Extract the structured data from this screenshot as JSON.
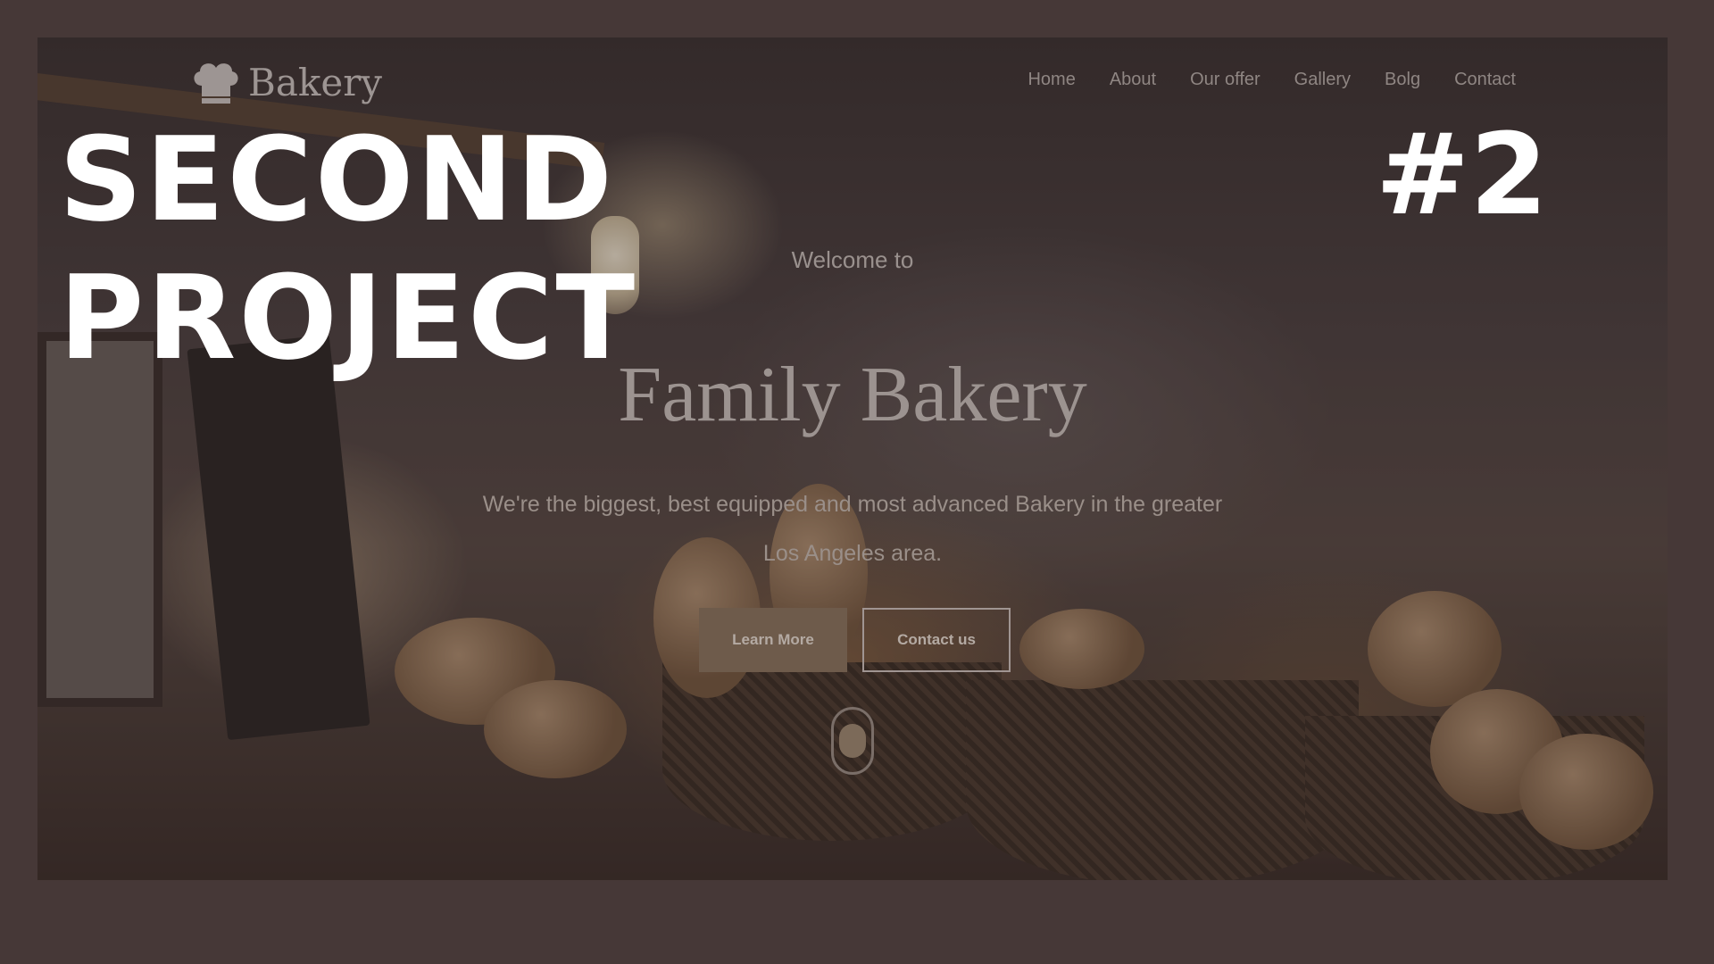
{
  "overlay": {
    "title_line1": "SECOND",
    "title_line2": "PROJECT",
    "number": "#2"
  },
  "site": {
    "logo_text": "Bakery",
    "logo_icon": "chef-hat-icon",
    "nav": {
      "home": "Home",
      "about": "About",
      "offer": "Our offer",
      "gallery": "Gallery",
      "blog": "Bolg",
      "contact": "Contact"
    },
    "hero": {
      "welcome": "Welcome to",
      "title": "Family Bakery",
      "description_line1": "We're the biggest, best equipped and most advanced Bakery in the greater",
      "description_line2": "Los Angeles area.",
      "learn_more": "Learn More",
      "contact_us": "Contact us"
    }
  },
  "colors": {
    "background": "#463837",
    "accent_button": "#6e5b4b",
    "overlay_text": "#ffffff"
  }
}
